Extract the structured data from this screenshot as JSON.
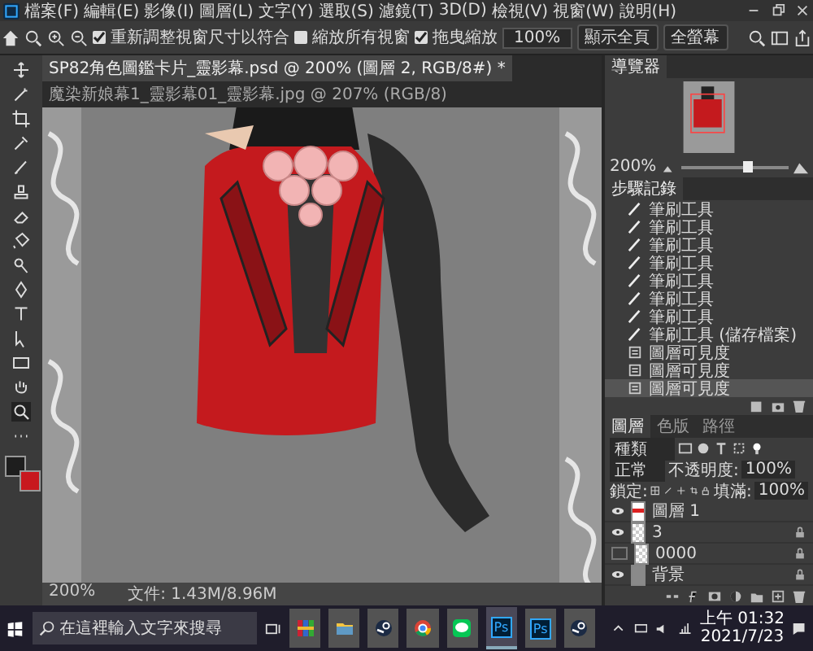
{
  "menu": [
    "檔案(F)",
    "編輯(E)",
    "影像(I)",
    "圖層(L)",
    "文字(Y)",
    "選取(S)",
    "濾鏡(T)",
    "3D(D)",
    "檢視(V)",
    "視窗(W)",
    "說明(H)"
  ],
  "options": {
    "checkboxes": [
      {
        "label": "重新調整視窗尺寸以符合",
        "checked": true
      },
      {
        "label": "縮放所有視窗",
        "checked": false
      },
      {
        "label": "拖曳縮放",
        "checked": true
      }
    ],
    "zoom_field": "100%",
    "buttons": [
      "顯示全頁",
      "全螢幕"
    ]
  },
  "tabs": [
    {
      "label": "SP82角色圖鑑卡片_靈影幕.psd @ 200% (圖層 2, RGB/8#) *",
      "selected": true
    },
    {
      "label": "魔染新娘幕1_靈影幕01_靈影幕.jpg @ 207% (RGB/8)",
      "selected": false
    }
  ],
  "swatches": [
    {
      "kind": "foreground",
      "color": "#1e1e1e"
    },
    {
      "kind": "background",
      "color": "#c8181e"
    }
  ],
  "navigator": {
    "title": "導覽器",
    "zoom": "200%",
    "level": 0.62
  },
  "history": {
    "title": "步驟記錄",
    "items": [
      {
        "kind": "brush",
        "label": "筆刷工具",
        "selected": false
      },
      {
        "kind": "brush",
        "label": "筆刷工具",
        "selected": false
      },
      {
        "kind": "brush",
        "label": "筆刷工具",
        "selected": false
      },
      {
        "kind": "brush",
        "label": "筆刷工具",
        "selected": false
      },
      {
        "kind": "brush",
        "label": "筆刷工具",
        "selected": false
      },
      {
        "kind": "brush",
        "label": "筆刷工具",
        "selected": false
      },
      {
        "kind": "brush",
        "label": "筆刷工具",
        "selected": false
      },
      {
        "kind": "brush",
        "label": "筆刷工具 (儲存檔案)",
        "selected": false
      },
      {
        "kind": "layer",
        "label": "圖層可見度",
        "selected": false
      },
      {
        "kind": "layer",
        "label": "圖層可見度",
        "selected": false
      },
      {
        "kind": "layer",
        "label": "圖層可見度",
        "selected": true
      }
    ]
  },
  "layers": {
    "tabs": [
      {
        "label": "圖層",
        "selected": true
      },
      {
        "label": "色版",
        "selected": false
      },
      {
        "label": "路徑",
        "selected": false
      }
    ],
    "filter": "種類",
    "blend_mode": "正常",
    "opacity_label": "不透明度:",
    "opacity": "100%",
    "lock_label": "鎖定:",
    "fill_label": "填滿:",
    "fill": "100%",
    "list": [
      {
        "name": "圖層 1",
        "kind": "art",
        "visible": true,
        "locked": false
      },
      {
        "name": "3",
        "kind": "transparent",
        "visible": true,
        "locked": true
      },
      {
        "name": "0000",
        "kind": "transparent",
        "visible": false,
        "locked": true
      },
      {
        "name": "背景",
        "kind": "fill",
        "visible": true,
        "locked": true
      }
    ]
  },
  "status_bar": {
    "zoom": "200%",
    "document": "文件: 1.43M/8.96M"
  },
  "taskbar": {
    "search_placeholder": "在這裡輸入文字來搜尋",
    "apps": [
      {
        "kind": "archive",
        "active": false
      },
      {
        "kind": "folder",
        "active": false
      },
      {
        "kind": "steam",
        "active": false
      },
      {
        "kind": "browser",
        "active": false
      },
      {
        "kind": "chat",
        "active": false
      },
      {
        "kind": "ps",
        "label": "Ps",
        "active": true
      },
      {
        "kind": "ps",
        "label": "Ps",
        "active": false
      },
      {
        "kind": "steam",
        "active": false
      }
    ],
    "time": "上午 01:32",
    "date": "2021/7/23"
  }
}
